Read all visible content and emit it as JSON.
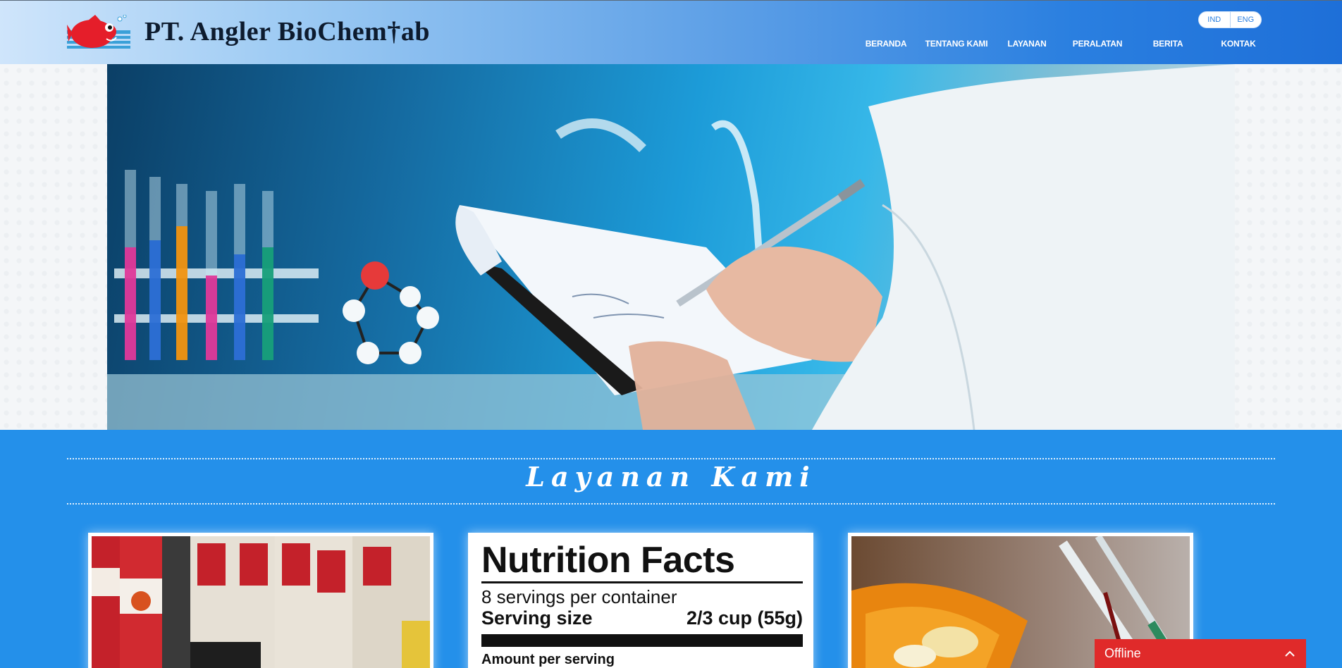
{
  "brand": {
    "name": "PT. Angler  BioChemLab",
    "name_display": "PT. Angler  BioChem†ab",
    "logo_icon": "red-fish-logo-icon"
  },
  "language": {
    "options": [
      "IND",
      "ENG"
    ],
    "selected": "IND"
  },
  "nav": {
    "items": [
      "BERANDA",
      "TENTANG KAMI",
      "LAYANAN",
      "PERALATAN",
      "BERITA",
      "KONTAK"
    ]
  },
  "hero": {
    "image": "scientist-writing-in-lab-photo"
  },
  "services": {
    "title": "Layanan Kami",
    "cards": [
      {
        "image": "canned-food-photo"
      },
      {
        "image": "nutrition-facts-label",
        "label": {
          "title": "Nutrition Facts",
          "servings": "8 servings per container",
          "serving_size_label": "Serving size",
          "serving_size_value": "2/3 cup (55g)",
          "amount": "Amount per serving"
        }
      },
      {
        "image": "medicine-pills-syringe-photo"
      }
    ]
  },
  "chat": {
    "status": "Offline",
    "toggle_icon": "chevron-up-icon"
  },
  "colors": {
    "header_start": "#cfe5fb",
    "header_end": "#1e6fd8",
    "services_bg": "#2490ea",
    "offline_bg": "#e02a2a"
  }
}
